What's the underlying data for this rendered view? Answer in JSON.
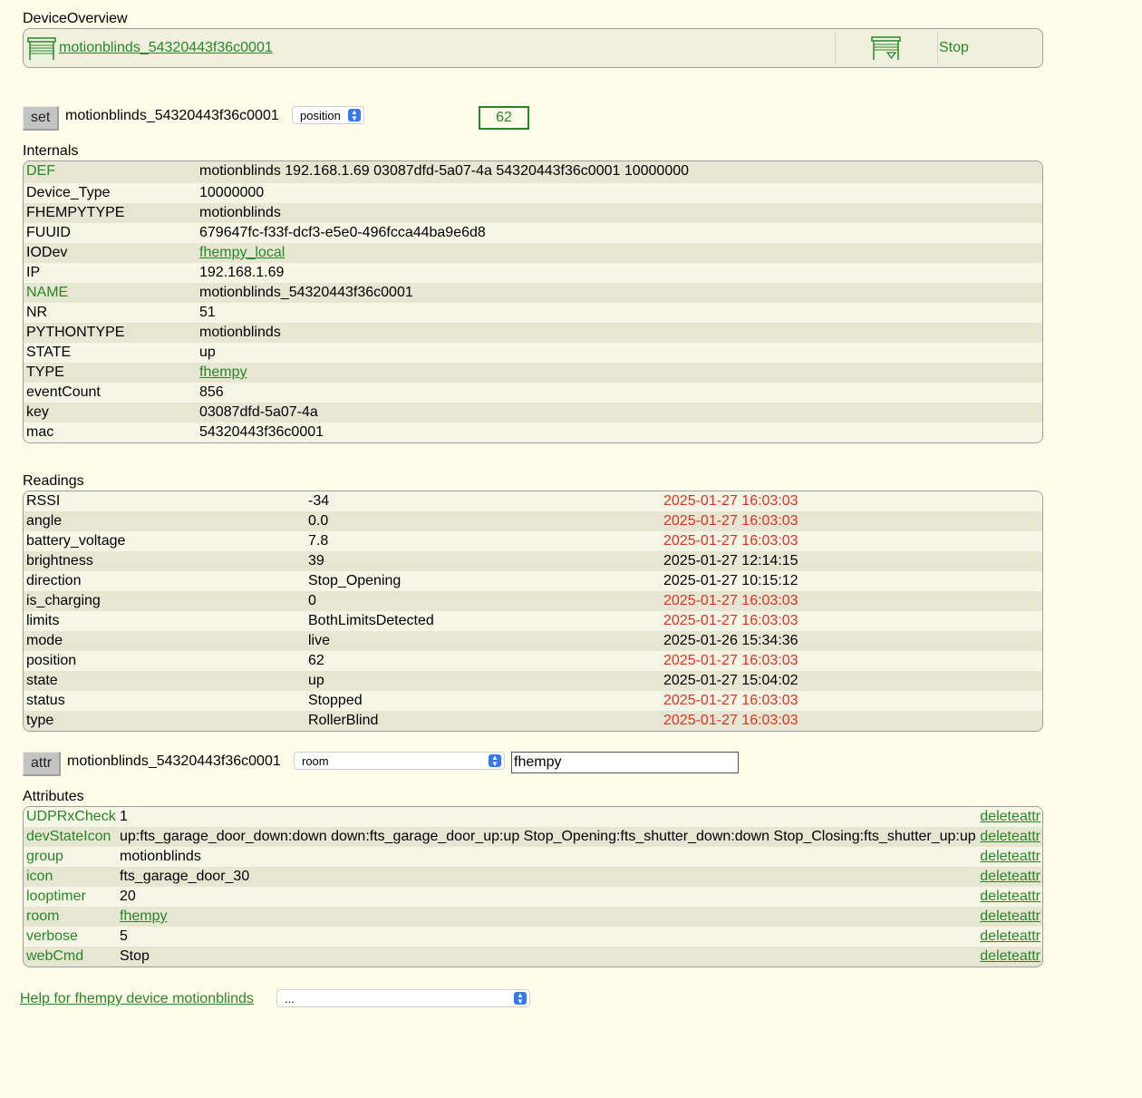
{
  "device_overview": {
    "heading": "DeviceOverview",
    "device_link": "motionblinds_54320443f36c0001",
    "stop_command": "Stop"
  },
  "set_line": {
    "button": "set",
    "device": "motionblinds_54320443f36c0001",
    "selected": "position",
    "value": "62"
  },
  "internals": {
    "heading": "Internals",
    "rows": [
      {
        "key": "DEF",
        "value": "motionblinds 192.168.1.69 03087dfd-5a07-4a 54320443f36c0001 10000000"
      },
      {
        "key": "Device_Type",
        "value": "10000000"
      },
      {
        "key": "FHEMPYTYPE",
        "value": "motionblinds"
      },
      {
        "key": "FUUID",
        "value": "679647fc-f33f-dcf3-e5e0-496fcca44ba9e6d8"
      },
      {
        "key": "IODev",
        "value": "fhempy_local"
      },
      {
        "key": "IP",
        "value": "192.168.1.69"
      },
      {
        "key": "NAME",
        "value": "motionblinds_54320443f36c0001"
      },
      {
        "key": "NR",
        "value": "51"
      },
      {
        "key": "PYTHONTYPE",
        "value": "motionblinds"
      },
      {
        "key": "STATE",
        "value": "up"
      },
      {
        "key": "TYPE",
        "value": "fhempy"
      },
      {
        "key": "eventCount",
        "value": "856"
      },
      {
        "key": "key",
        "value": "03087dfd-5a07-4a"
      },
      {
        "key": "mac",
        "value": "54320443f36c0001"
      }
    ]
  },
  "readings": {
    "heading": "Readings",
    "rows": [
      {
        "name": "RSSI",
        "value": "-34",
        "time": "2025-01-27 16:03:03",
        "recent": true
      },
      {
        "name": "angle",
        "value": "0.0",
        "time": "2025-01-27 16:03:03",
        "recent": true
      },
      {
        "name": "battery_voltage",
        "value": "7.8",
        "time": "2025-01-27 16:03:03",
        "recent": true
      },
      {
        "name": "brightness",
        "value": "39",
        "time": "2025-01-27 12:14:15",
        "recent": false
      },
      {
        "name": "direction",
        "value": "Stop_Opening",
        "time": "2025-01-27 10:15:12",
        "recent": false
      },
      {
        "name": "is_charging",
        "value": "0",
        "time": "2025-01-27 16:03:03",
        "recent": true
      },
      {
        "name": "limits",
        "value": "BothLimitsDetected",
        "time": "2025-01-27 16:03:03",
        "recent": true
      },
      {
        "name": "mode",
        "value": "live",
        "time": "2025-01-26 15:34:36",
        "recent": false
      },
      {
        "name": "position",
        "value": "62",
        "time": "2025-01-27 16:03:03",
        "recent": true
      },
      {
        "name": "state",
        "value": "up",
        "time": "2025-01-27 15:04:02",
        "recent": false
      },
      {
        "name": "status",
        "value": "Stopped",
        "time": "2025-01-27 16:03:03",
        "recent": true
      },
      {
        "name": "type",
        "value": "RollerBlind",
        "time": "2025-01-27 16:03:03",
        "recent": true
      }
    ]
  },
  "attr_line": {
    "button": "attr",
    "device": "motionblinds_54320443f36c0001",
    "selected": "room",
    "value": "fhempy"
  },
  "attributes": {
    "heading": "Attributes",
    "delete_label": "deleteattr",
    "rows": [
      {
        "name": "UDPRxCheck",
        "value": "1"
      },
      {
        "name": "devStateIcon",
        "value": "up:fts_garage_door_down:down down:fts_garage_door_up:up Stop_Opening:fts_shutter_down:down Stop_Closing:fts_shutter_up:up"
      },
      {
        "name": "group",
        "value": "motionblinds"
      },
      {
        "name": "icon",
        "value": "fts_garage_door_30"
      },
      {
        "name": "looptimer",
        "value": "20"
      },
      {
        "name": "room",
        "value": "fhempy"
      },
      {
        "name": "verbose",
        "value": "5"
      },
      {
        "name": "webCmd",
        "value": "Stop"
      }
    ]
  },
  "footer": {
    "help_link": "Help for fhempy device motionblinds",
    "select_value": "..."
  },
  "colors": {
    "link": "#278727",
    "recent_timestamp": "#e0321e",
    "background": "#fffde9"
  }
}
